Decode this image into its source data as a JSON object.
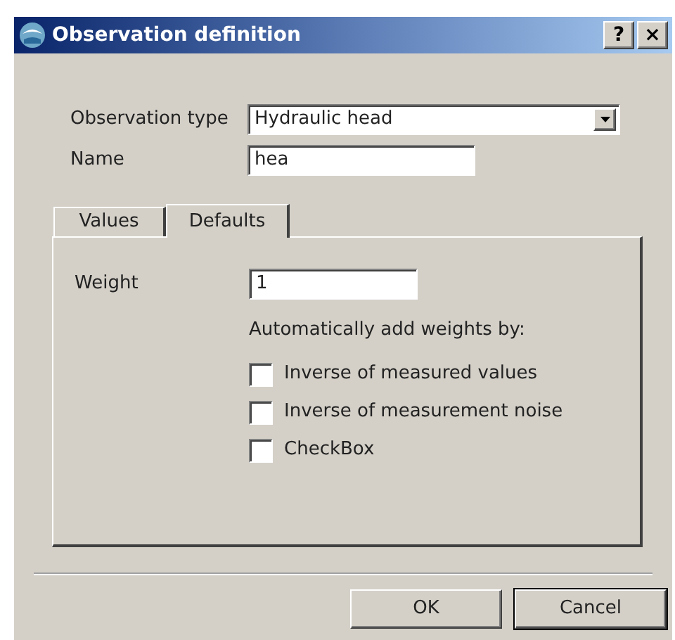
{
  "window": {
    "title": "Observation definition",
    "buttons": [
      "?",
      "×"
    ]
  },
  "fields": [
    {
      "kind": "combo",
      "label": "Observation type",
      "value": "Hydraulic head"
    },
    {
      "kind": "text",
      "label": "Name",
      "value": "hea"
    }
  ],
  "tabs": [
    {
      "label": "Values",
      "selected": false
    },
    {
      "label": "Defaults",
      "selected": true
    }
  ],
  "defaults": {
    "weight_label": "Weight",
    "weight_value": "1",
    "auto_label": "Automatically add weights by:",
    "options": [
      {
        "label": "Inverse of measured values",
        "checked": false
      },
      {
        "label": "Inverse of measurement noise",
        "checked": false
      },
      {
        "label": "CheckBox",
        "checked": false
      }
    ]
  },
  "buttons": [
    {
      "label": "OK",
      "default": false
    },
    {
      "label": "Cancel",
      "default": true
    }
  ]
}
